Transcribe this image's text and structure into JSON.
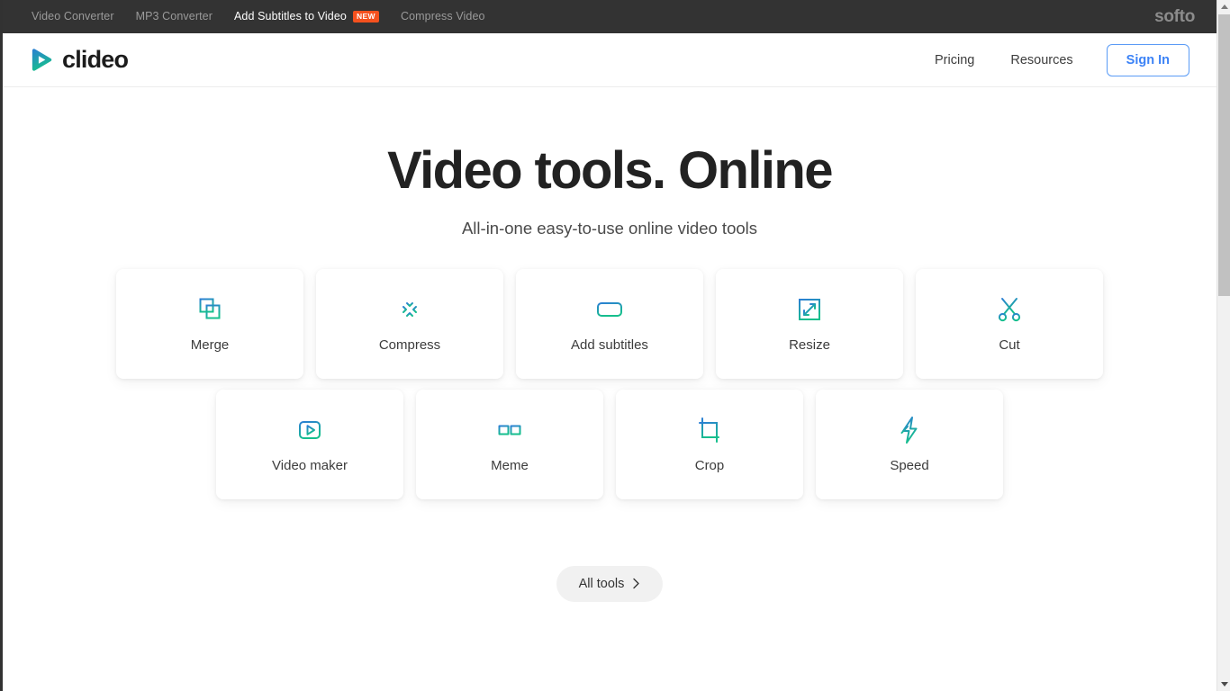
{
  "topbar": {
    "links": [
      {
        "label": "Video Converter",
        "active": false,
        "badge": null
      },
      {
        "label": "MP3 Converter",
        "active": false,
        "badge": null
      },
      {
        "label": "Add Subtitles to Video",
        "active": true,
        "badge": "NEW"
      },
      {
        "label": "Compress Video",
        "active": false,
        "badge": null
      }
    ],
    "brand": "softo"
  },
  "header": {
    "logo_text": "clideo",
    "nav": [
      {
        "label": "Pricing"
      },
      {
        "label": "Resources"
      }
    ],
    "signin_label": "Sign In"
  },
  "hero": {
    "title": "Video tools. Online",
    "subtitle": "All-in-one easy-to-use online video tools"
  },
  "tools": {
    "row1": [
      {
        "label": "Merge",
        "icon": "merge-icon"
      },
      {
        "label": "Compress",
        "icon": "compress-icon"
      },
      {
        "label": "Add subtitles",
        "icon": "subtitles-icon"
      },
      {
        "label": "Resize",
        "icon": "resize-icon"
      },
      {
        "label": "Cut",
        "icon": "scissors-icon"
      }
    ],
    "row2": [
      {
        "label": "Video maker",
        "icon": "video-maker-icon"
      },
      {
        "label": "Meme",
        "icon": "meme-icon"
      },
      {
        "label": "Crop",
        "icon": "crop-icon"
      },
      {
        "label": "Speed",
        "icon": "speed-icon"
      }
    ],
    "all_tools_label": "All tools"
  },
  "colors": {
    "accent_blue": "#3b82f6",
    "gradient_start": "#2b7fd4",
    "gradient_end": "#16bf8d",
    "badge_orange": "#f4511e",
    "topbar_bg": "#333333"
  }
}
